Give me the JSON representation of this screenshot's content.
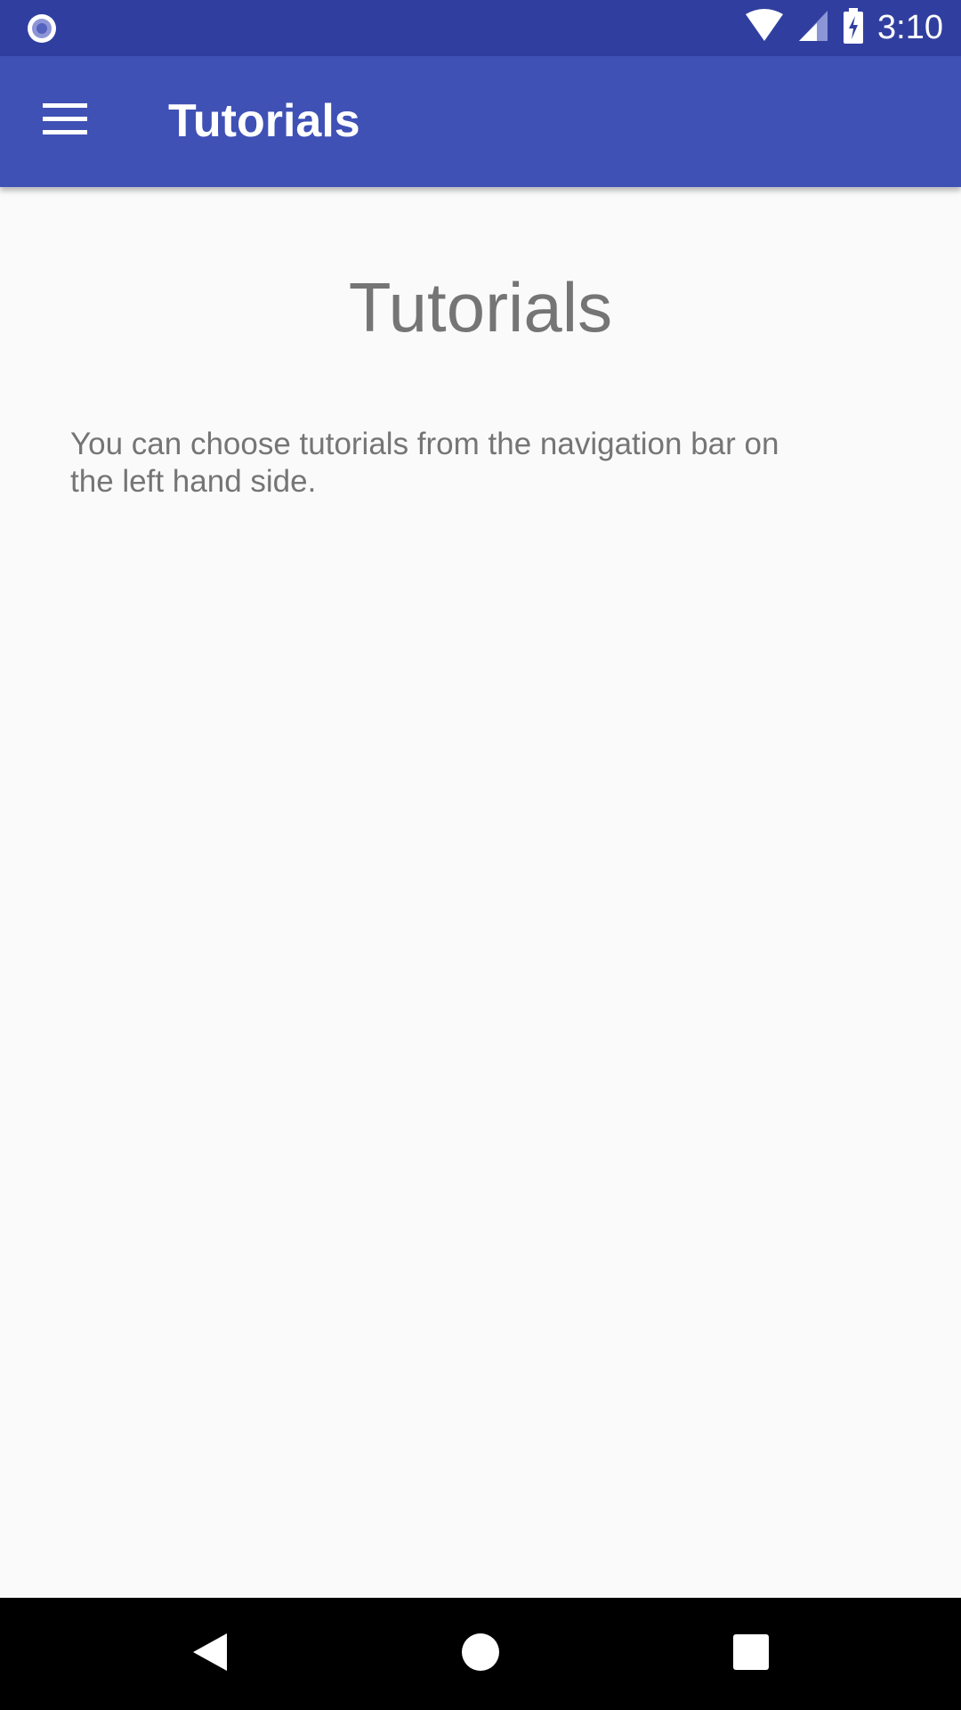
{
  "status_bar": {
    "time": "3:10",
    "left_icon": "sync-circle-icon",
    "icons": [
      "wifi-icon",
      "cell-signal-icon",
      "battery-charging-icon"
    ],
    "color": "#303f9f"
  },
  "app_bar": {
    "title": "Tutorials",
    "menu_icon": "menu-icon",
    "color": "#3f51b5"
  },
  "main": {
    "heading": "Tutorials",
    "description": "You can choose tutorials from the navigation bar on the left hand side."
  },
  "nav_bar": {
    "buttons": [
      "back-icon",
      "home-icon",
      "recents-icon"
    ]
  }
}
